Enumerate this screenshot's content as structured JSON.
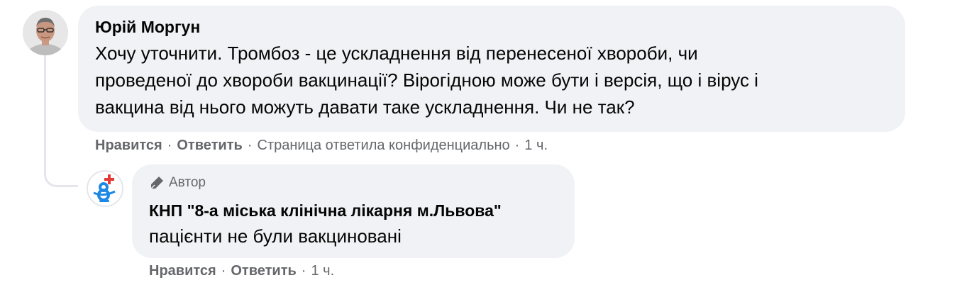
{
  "comment": {
    "author": "Юрій Моргун",
    "text": "Хочу уточнити. Тромбоз - це ускладнення від перенесеної хвороби, чи\nпроведеної до хвороби вакцинації? Вірогідною може бути і версія, що і вірус і\nвакцина від нього можуть давати таке ускладнення. Чи не так?",
    "actions": {
      "like": "Нравится",
      "reply": "Ответить",
      "note": "Страница ответила конфиденциально",
      "time": "1 ч."
    }
  },
  "reply": {
    "badge_icon": "pen-icon",
    "badge_label": "Автор",
    "page_name": "КНП \"8-а міська клінічна лікарня м.Львова\"",
    "text": "пацієнти не були вакциновані",
    "actions": {
      "like": "Нравится",
      "reply": "Ответить",
      "time": "1 ч."
    }
  },
  "colors": {
    "bubble": "#f0f2f5",
    "secondary_text": "#65676b",
    "primary_text": "#050505",
    "logo_blue": "#1e88e5",
    "logo_red": "#e53935"
  }
}
